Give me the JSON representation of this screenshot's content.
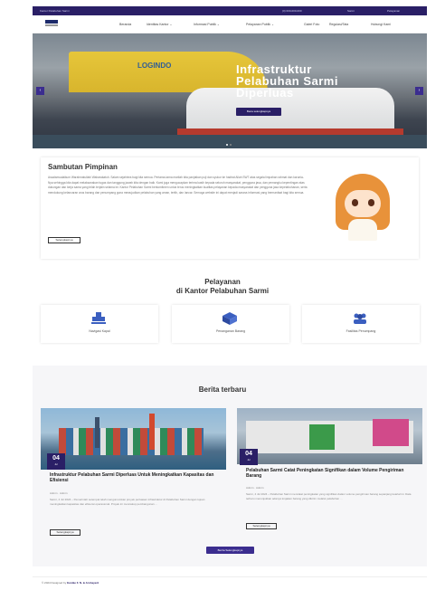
{
  "topbar": {
    "left": "Kantor Pelabuhan Sarmi",
    "phone": "(0) 000-000-000",
    "email": "Sarmi",
    "social": "Pelayanan"
  },
  "nav": {
    "items": [
      "Beranda",
      "Identitas Kantor ⌄",
      "Informasi Publik ⌄",
      "Pelayanan Publik ⌄",
      "Galeri Foto",
      "Regulasi/Tata",
      "Hubungi Kami"
    ]
  },
  "hero": {
    "ship_label": "LOGINDO",
    "title_line1": "Infrastruktur",
    "title_line2": "Pelabuhan Sarmi",
    "title_line3": "Diperluas",
    "button": "Baca selengkapnya",
    "prev": "‹",
    "next": "›"
  },
  "sambutan": {
    "title": "Sambutan Pimpinan",
    "text": "Assalamualaikum Warahmatullahi Wabarakatuh. Salam sejahtera bagi kita semua. Pertama-tama marilah kita panjatkan puji dan syukur ke hadirat Allah SWT atas segala limpahan rahmat dan karunia-Nya sehingga kita dapat melaksanakan tugas dan tanggung jawab kita dengan baik. Kami juga mengucapkan terima kasih kepada seluruh masyarakat, pengguna jasa, dan pemangku kepentingan atas dukungan dan kerja sama yang telah terjalin selama ini. Kantor Pelabuhan Sarmi berkomitmen untuk terus meningkatkan kualitas pelayanan kepada masyarakat dan pengguna jasa kepelabuhanan, serta mendukung kelancaran arus barang dan penumpang guna mewujudkan pelabuhan yang aman, tertib, dan lancar. Semoga website ini dapat menjadi sarana informasi yang bermanfaat bagi kita semua.",
    "button": "Selengkapnya"
  },
  "layanan": {
    "title_line1": "Pelayanan",
    "title_line2": "di Kantor Pelabuhan Sarmi",
    "items": [
      {
        "label": "Navigasi Kapal",
        "icon": "ship-icon"
      },
      {
        "label": "Penanganan Barang",
        "icon": "box-icon"
      },
      {
        "label": "Fasilitas Penumpang",
        "icon": "users-icon"
      }
    ]
  },
  "berita": {
    "title": "Berita terbaru",
    "items": [
      {
        "day": "04",
        "month": "Jul",
        "title": "Infrastruktur Pelabuhan Sarmi Diperluas Untuk Meningkatkan Kapasitas dan Efisiensi",
        "meta": "Admin · Admin",
        "text": "Sarmi, 4 Jul 2024 – Pemerintah setempat telah mengumumkan proyek perluasan infrastruktur di Pelabuhan Sarmi dengan tujuan meningkatkan kapasitas dan efisiensi operasional. Proyek ini mencakup pembangunan …",
        "button": "Selengkapnya"
      },
      {
        "day": "04",
        "month": "Jul",
        "title": "Pelabuhan Sarmi Catat Peningkatan Signifikan dalam Volume Pengiriman Barang",
        "meta": "Admin · Admin",
        "text": "Sarmi, 4 Jul 2024 – Pelabuhan Sarmi mencatat peningkatan yang signifikan dalam volume pengiriman barang sepanjang kuartal ini. Data terbaru menunjukkan adanya lonjakan barang yang dikirim melalui pelabuhan …",
        "button": "Selengkapnya"
      }
    ],
    "more": "Berita Selengkapnya"
  },
  "footer": {
    "text": "© 2024 Designed by",
    "author": "Eunike F. N. & Arshayenl"
  },
  "colors": {
    "primary": "#2a1f66",
    "accent": "#3b2d8f"
  }
}
